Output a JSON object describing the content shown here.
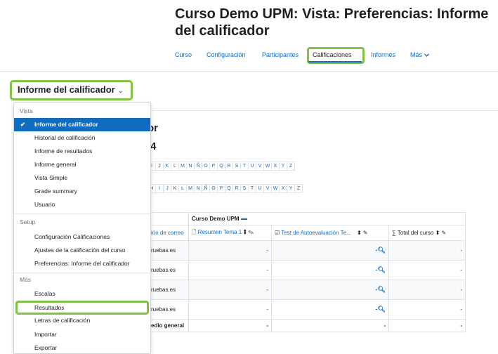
{
  "page": {
    "title": "Curso Demo UPM: Vista: Preferencias: Informe del calificador"
  },
  "nav": {
    "tabs": [
      "Curso",
      "Configuración",
      "Participantes",
      "Calificaciones",
      "Informes",
      "Más"
    ],
    "active": "Calificaciones",
    "more_chevron": "chevron-down"
  },
  "report_selector": {
    "label": "Informe del calificador",
    "chevron": "chevron-down"
  },
  "background": {
    "title_fragment": "or",
    "subtitle_fragment": "/4",
    "letters_row1": [
      "I",
      "J",
      "K",
      "L",
      "M",
      "N",
      "Ñ",
      "O",
      "P",
      "Q",
      "R",
      "S",
      "T",
      "U",
      "V",
      "W",
      "X",
      "Y",
      "Z"
    ],
    "letters_row2": [
      "H",
      "I",
      "J",
      "K",
      "L",
      "M",
      "N",
      "Ñ",
      "O",
      "P",
      "Q",
      "R",
      "S",
      "T",
      "U",
      "V",
      "W",
      "X",
      "Y",
      "Z"
    ]
  },
  "grade_table": {
    "course_header": "Curso Demo UPM",
    "columns": [
      {
        "label": "ión de correo",
        "icon": ""
      },
      {
        "label": "Resumen Tema 1",
        "icon": "document-icon"
      },
      {
        "label": "Test de Autoevaluación Te...",
        "icon": "quiz-icon"
      },
      {
        "label": "Total del curso",
        "icon": "sigma-icon"
      }
    ],
    "rows": [
      {
        "email": "ruebas.es",
        "resumen": "-",
        "test": "-",
        "total": "-"
      },
      {
        "email": "ruebas.es",
        "resumen": "-",
        "test": "-",
        "total": "-"
      },
      {
        "email": "ruebas.es",
        "resumen": "-",
        "test": "-",
        "total": "-"
      },
      {
        "email": "ruebas.es",
        "resumen": "-",
        "test": "-",
        "total": "-"
      }
    ],
    "average": {
      "label": "edio general",
      "resumen": "-",
      "test": "-",
      "total": "-"
    }
  },
  "dropdown": {
    "sections": [
      {
        "header": "Vista",
        "items": [
          "Informe del calificador",
          "Historial de calificación",
          "Informe de resultados",
          "Informe general",
          "Vista Simple",
          "Grade summary",
          "Usuario"
        ]
      },
      {
        "header": "Setup",
        "items": [
          "Configuración Calificaciones",
          "Ajustes de la calificación del curso",
          "Preferencias: Informe del calificador"
        ]
      },
      {
        "header": "Más",
        "items": [
          "Escalas",
          "Resultados",
          "Letras de calificación",
          "Importar",
          "Exportar"
        ]
      }
    ],
    "selected": "Informe del calificador",
    "highlighted": "Resultados"
  },
  "colors": {
    "primary": "#0f6cbf",
    "highlight": "#80c342"
  }
}
